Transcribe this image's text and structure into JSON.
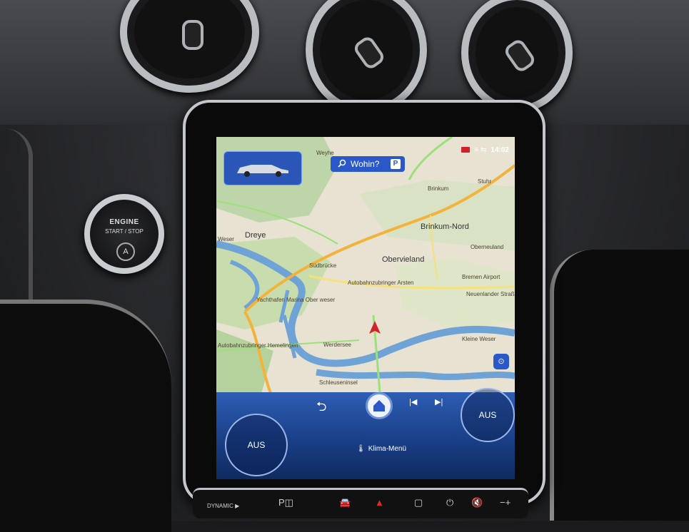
{
  "engine_button": {
    "line1": "ENGINE",
    "line2": "START / STOP",
    "auto_symbol": "A"
  },
  "status_bar": {
    "time": "14:02",
    "signal": "≡ ⇆"
  },
  "search": {
    "label": "Wohin?",
    "parking": "P"
  },
  "map_labels": [
    "Weyhe",
    "Brinkum",
    "Brinkum-Nord",
    "Dreye",
    "Weser",
    "Obervieland",
    "Stuhr",
    "Bremen Airport",
    "Yachthafen Marina Ober weser",
    "Autobahnzubringer Arsten",
    "Neuenlander Straße",
    "Autobahnzubringer Hemelingen",
    "Werdersee",
    "Kleine Weser",
    "Schleuseninsel",
    "Oberneuland",
    "Südbrücke"
  ],
  "bottom_bar": {
    "left_dial": "AUS",
    "right_dial": "AUS",
    "back_icon": "back-arrow-icon",
    "home_icon": "home-icon",
    "prev_icon": "skip-previous-icon",
    "next_icon": "skip-next-icon",
    "klima_label": "Klima-Menü"
  },
  "hardware_buttons": {
    "dynamic_label": "DYNAMIC ▶"
  },
  "colors": {
    "accent": "#2a58c8",
    "panel": "#1a3f86",
    "hazard": "#e12b2b"
  }
}
